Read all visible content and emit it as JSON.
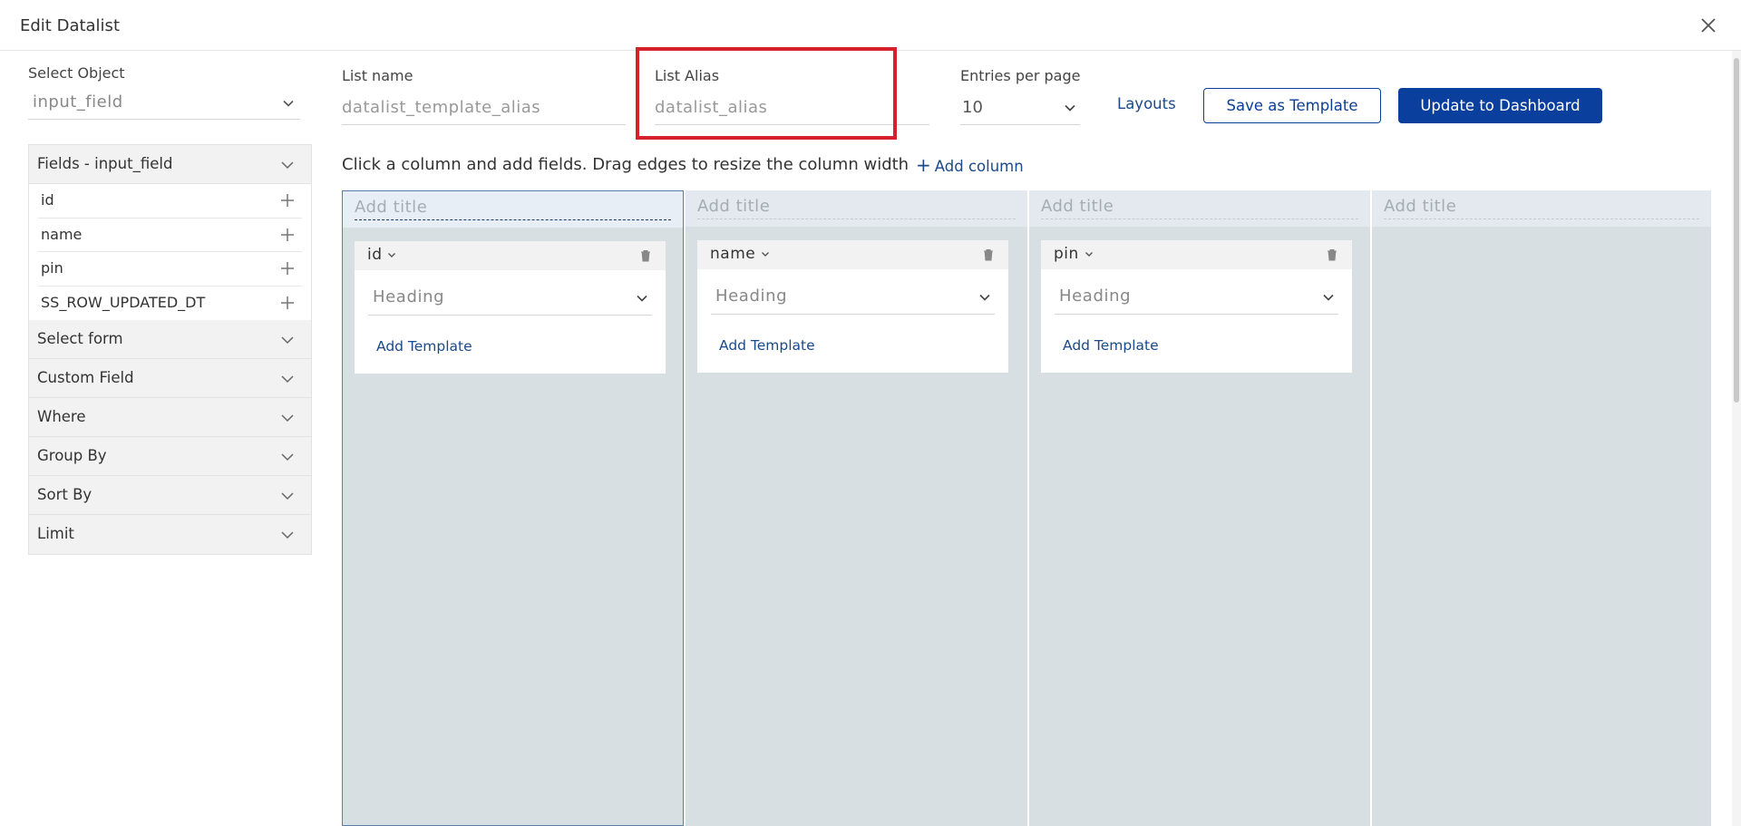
{
  "dialog": {
    "title": "Edit Datalist"
  },
  "object": {
    "label": "Select Object",
    "value": "input_field"
  },
  "sidebar": {
    "fields_header": "Fields - input_field",
    "fields": [
      {
        "label": "id"
      },
      {
        "label": "name"
      },
      {
        "label": "pin"
      },
      {
        "label": "SS_ROW_UPDATED_DT"
      }
    ],
    "sections": [
      {
        "label": "Select form"
      },
      {
        "label": "Custom Field"
      },
      {
        "label": "Where"
      },
      {
        "label": "Group By"
      },
      {
        "label": "Sort By"
      },
      {
        "label": "Limit"
      }
    ]
  },
  "form": {
    "list_name": {
      "label": "List name",
      "value": "datalist_template_alias"
    },
    "list_alias": {
      "label": "List Alias",
      "value": "datalist_alias"
    },
    "entries": {
      "label": "Entries per page",
      "value": "10"
    }
  },
  "toolbar": {
    "layouts": "Layouts",
    "save_template": "Save as Template",
    "update_dashboard": "Update to Dashboard"
  },
  "builder": {
    "instructions": "Click a column and add fields. Drag edges to resize the column width",
    "add_column": "Add column",
    "columns": [
      {
        "title_placeholder": "Add title",
        "field": "id",
        "heading": "Heading",
        "add_template": "Add Template"
      },
      {
        "title_placeholder": "Add title",
        "field": "name",
        "heading": "Heading",
        "add_template": "Add Template"
      },
      {
        "title_placeholder": "Add title",
        "field": "pin",
        "heading": "Heading",
        "add_template": "Add Template"
      },
      {
        "title_placeholder": "Add title"
      }
    ]
  },
  "colors": {
    "primary": "#0b3f9e",
    "link": "#1a4a8a",
    "highlight": "#d3222b",
    "column_bg": "#d8dfe2"
  }
}
